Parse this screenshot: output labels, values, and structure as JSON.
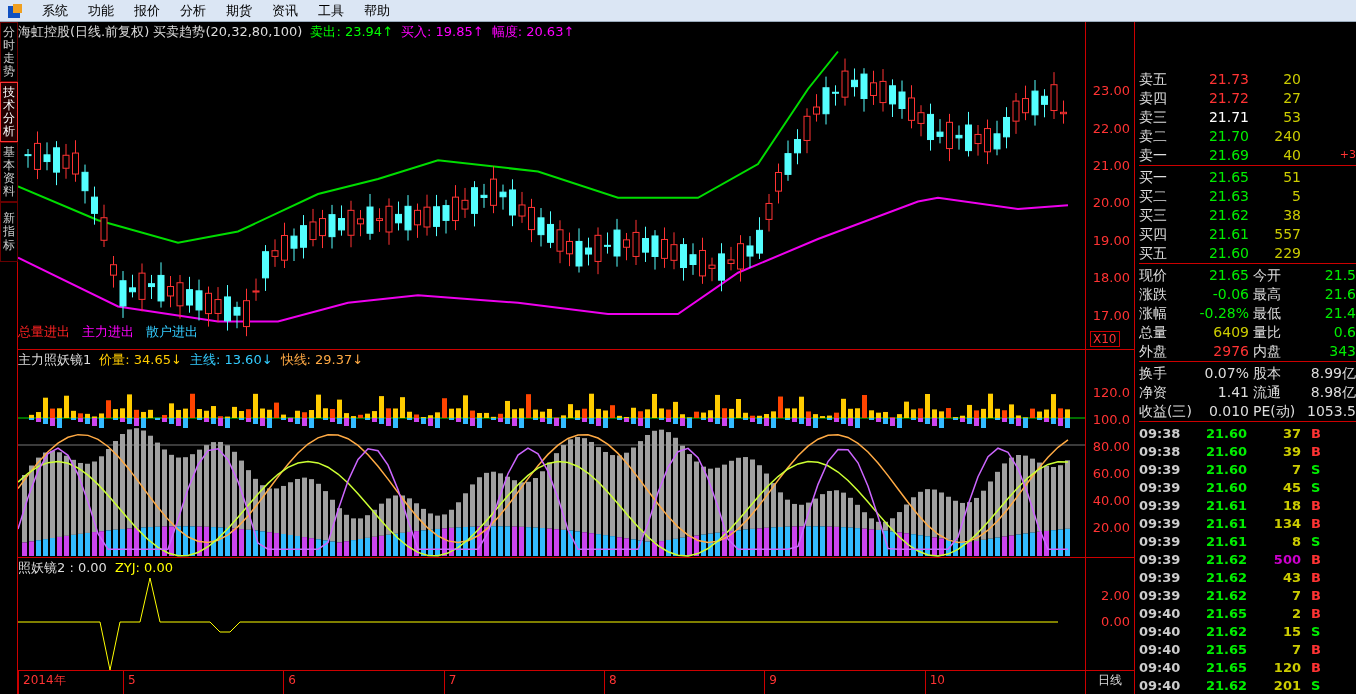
{
  "menu": [
    {
      "label": "系统"
    },
    {
      "label": "功能"
    },
    {
      "label": "报价"
    },
    {
      "label": "分析"
    },
    {
      "label": "期货"
    },
    {
      "label": "资讯"
    },
    {
      "label": "工具"
    },
    {
      "label": "帮助"
    }
  ],
  "side_tabs": [
    {
      "label": "分时走势",
      "selected": false
    },
    {
      "label": "技术分析",
      "selected": true
    },
    {
      "label": "基本资料",
      "selected": false
    },
    {
      "label": "新指标",
      "selected": false
    }
  ],
  "main_chart": {
    "title": "海虹控股(日线.前复权) 买卖趋势(20,32,80,100)",
    "readings": [
      {
        "label": "卖出: 23.94",
        "arrow": "↑",
        "kind": "sell"
      },
      {
        "label": "买入: 19.85",
        "arrow": "↑",
        "kind": "buy"
      },
      {
        "label": "幅度: 20.63",
        "arrow": "↑",
        "kind": "range"
      }
    ],
    "legend": [
      {
        "label": "总量进出",
        "kind": "total"
      },
      {
        "label": "主力进出",
        "kind": "main"
      },
      {
        "label": "散户进出",
        "kind": "retail"
      }
    ],
    "yticks": [
      "23.00",
      "22.00",
      "21.00",
      "20.00",
      "19.00",
      "18.00",
      "17.00"
    ],
    "scale": "X10"
  },
  "indicator_1": {
    "title": "主力照妖镜1",
    "readings": [
      {
        "label": "价量: 34.65",
        "arrow": "↓",
        "kind": "volume"
      },
      {
        "label": "主线: 13.60",
        "arrow": "↓",
        "kind": "main"
      },
      {
        "label": "快线: 29.37",
        "arrow": "↓",
        "kind": "fast"
      }
    ],
    "yticks": [
      "120.0",
      "100.0",
      "80.00",
      "60.00",
      "40.00",
      "20.00"
    ]
  },
  "indicator_2": {
    "title": "照妖镜2 : 0.00",
    "readings": [
      {
        "label": "ZYJ: 0.00",
        "kind": "zyj"
      }
    ],
    "yticks": [
      "2.00",
      "0.00"
    ]
  },
  "time_axis": {
    "labels": [
      "2014年",
      "5",
      "6",
      "7",
      "8",
      "9",
      "10"
    ],
    "period": "日线"
  },
  "order_book": {
    "asks": [
      {
        "label": "卖五",
        "price": "21.73",
        "volume": "20",
        "color": "#ff3333"
      },
      {
        "label": "卖四",
        "price": "21.72",
        "volume": "27",
        "color": "#ff3333"
      },
      {
        "label": "卖三",
        "price": "21.71",
        "volume": "53",
        "color": "#ffffff"
      },
      {
        "label": "卖二",
        "price": "21.70",
        "volume": "240",
        "color": "#00ee00"
      },
      {
        "label": "卖一",
        "price": "21.69",
        "volume": "40",
        "color": "#00ee00",
        "change": "+3"
      }
    ],
    "bids": [
      {
        "label": "买一",
        "price": "21.65",
        "volume": "51",
        "color": "#00ee00"
      },
      {
        "label": "买二",
        "price": "21.63",
        "volume": "5",
        "color": "#00ee00"
      },
      {
        "label": "买三",
        "price": "21.62",
        "volume": "38",
        "color": "#00ee00"
      },
      {
        "label": "买四",
        "price": "21.61",
        "volume": "557",
        "color": "#00ee00"
      },
      {
        "label": "买五",
        "price": "21.60",
        "volume": "229",
        "color": "#00ee00"
      }
    ]
  },
  "quote": [
    {
      "items": [
        {
          "label": "现价",
          "value": "21.65",
          "color": "#00ee00"
        },
        {
          "label": "今开",
          "value": "21.5",
          "color": "#00ee00"
        }
      ]
    },
    {
      "items": [
        {
          "label": "涨跌",
          "value": "-0.06",
          "color": "#00ee00"
        },
        {
          "label": "最高",
          "value": "21.6",
          "color": "#00ee00"
        }
      ]
    },
    {
      "items": [
        {
          "label": "涨幅",
          "value": "-0.28%",
          "color": "#00ee00"
        },
        {
          "label": "最低",
          "value": "21.4",
          "color": "#00ee00"
        }
      ]
    },
    {
      "items": [
        {
          "label": "总量",
          "value": "6409",
          "color": "#cccc00"
        },
        {
          "label": "量比",
          "value": "0.6",
          "color": "#00ee00"
        }
      ]
    },
    {
      "items": [
        {
          "label": "外盘",
          "value": "2976",
          "color": "#ff3333"
        },
        {
          "label": "内盘",
          "value": "343",
          "color": "#00ee00"
        }
      ]
    }
  ],
  "fundamentals": [
    {
      "label": "换手",
      "value": "0.07%",
      "label_2": "股本",
      "value_2": "8.99亿"
    },
    {
      "label": "净资",
      "value": "1.41",
      "label_2": "流通",
      "value_2": "8.98亿"
    },
    {
      "label": "收益(三)",
      "value": "0.010",
      "label_2": "PE(动)",
      "value_2": "1053.5"
    }
  ],
  "ticks": [
    {
      "time": "09:38",
      "price": "21.60",
      "volume": {
        "value": "37",
        "color": "#cccc00"
      },
      "side": "B",
      "color": "#ff3333"
    },
    {
      "time": "09:38",
      "price": "21.60",
      "volume": {
        "value": "39",
        "color": "#cccc00"
      },
      "side": "B",
      "color": "#ff3333"
    },
    {
      "time": "09:39",
      "price": "21.60",
      "volume": {
        "value": "7",
        "color": "#cccc00"
      },
      "side": "S",
      "color": "#00ee00"
    },
    {
      "time": "09:39",
      "price": "21.60",
      "volume": {
        "value": "45",
        "color": "#cccc00"
      },
      "side": "S",
      "color": "#00ee00"
    },
    {
      "time": "09:39",
      "price": "21.61",
      "volume": {
        "value": "18",
        "color": "#cccc00"
      },
      "side": "B",
      "color": "#ff3333"
    },
    {
      "time": "09:39",
      "price": "21.61",
      "volume": {
        "value": "134",
        "color": "#cccc00"
      },
      "side": "B",
      "color": "#ff3333"
    },
    {
      "time": "09:39",
      "price": "21.61",
      "volume": {
        "value": "8",
        "color": "#cccc00"
      },
      "side": "S",
      "color": "#00ee00"
    },
    {
      "time": "09:39",
      "price": "21.62",
      "volume": {
        "value": "500",
        "color": "#cc00cc"
      },
      "side": "B",
      "color": "#ff3333"
    },
    {
      "time": "09:39",
      "price": "21.62",
      "volume": {
        "value": "43",
        "color": "#cccc00"
      },
      "side": "B",
      "color": "#ff3333"
    },
    {
      "time": "09:39",
      "price": "21.62",
      "volume": {
        "value": "7",
        "color": "#cccc00"
      },
      "side": "B",
      "color": "#ff3333"
    },
    {
      "time": "09:40",
      "price": "21.65",
      "volume": {
        "value": "2",
        "color": "#cccc00"
      },
      "side": "B",
      "color": "#ff3333"
    },
    {
      "time": "09:40",
      "price": "21.62",
      "volume": {
        "value": "15",
        "color": "#cccc00"
      },
      "side": "S",
      "color": "#00ee00"
    },
    {
      "time": "09:40",
      "price": "21.65",
      "volume": {
        "value": "7",
        "color": "#cccc00"
      },
      "side": "B",
      "color": "#ff3333"
    },
    {
      "time": "09:40",
      "price": "21.65",
      "volume": {
        "value": "120",
        "color": "#cccc00"
      },
      "side": "B",
      "color": "#ff3333"
    },
    {
      "time": "09:40",
      "price": "21.62",
      "volume": {
        "value": "201",
        "color": "#cccc00"
      },
      "side": "S",
      "color": "#00ee00"
    }
  ]
}
